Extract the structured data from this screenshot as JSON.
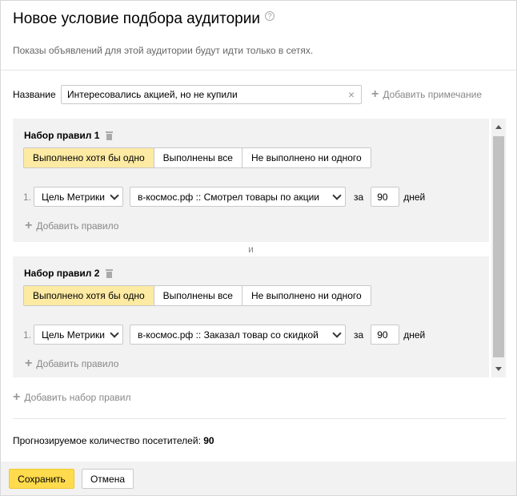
{
  "dialog": {
    "title": "Новое условие подбора аудитории",
    "subtitle": "Показы объявлений для этой аудитории будут идти только в сетях."
  },
  "name": {
    "label": "Название",
    "value": "Интересовались акцией, но не купили",
    "clear_icon": "×",
    "add_note": "Добавить примечание"
  },
  "rulesets": [
    {
      "title": "Набор правил 1",
      "options": [
        "Выполнено хотя бы одно",
        "Выполнены все",
        "Не выполнено ни одного"
      ],
      "selected_option": 0,
      "rule": {
        "num": "1.",
        "goal_type": "Цель Метрики",
        "target": "в-космос.рф :: Смотрел товары по акции",
        "za": "за",
        "days": "90",
        "days_label": "дней"
      },
      "add_rule": "Добавить правило"
    },
    {
      "title": "Набор правил 2",
      "options": [
        "Выполнено хотя бы одно",
        "Выполнены все",
        "Не выполнено ни одного"
      ],
      "selected_option": 0,
      "rule": {
        "num": "1.",
        "goal_type": "Цель Метрики",
        "target": "в-космос.рф :: Заказал товар со скидкой",
        "za": "за",
        "days": "90",
        "days_label": "дней"
      },
      "add_rule": "Добавить правило"
    }
  ],
  "and_label": "и",
  "add_ruleset": "Добавить набор правил",
  "forecast": {
    "label": "Прогнозируемое количество посетителей:",
    "value": "90"
  },
  "footer": {
    "save": "Сохранить",
    "cancel": "Отмена"
  },
  "colors": {
    "accent_button": "#ffdb4d",
    "selected_option": "#fdeaa3",
    "ruleset_bg": "#f2f2f2"
  }
}
